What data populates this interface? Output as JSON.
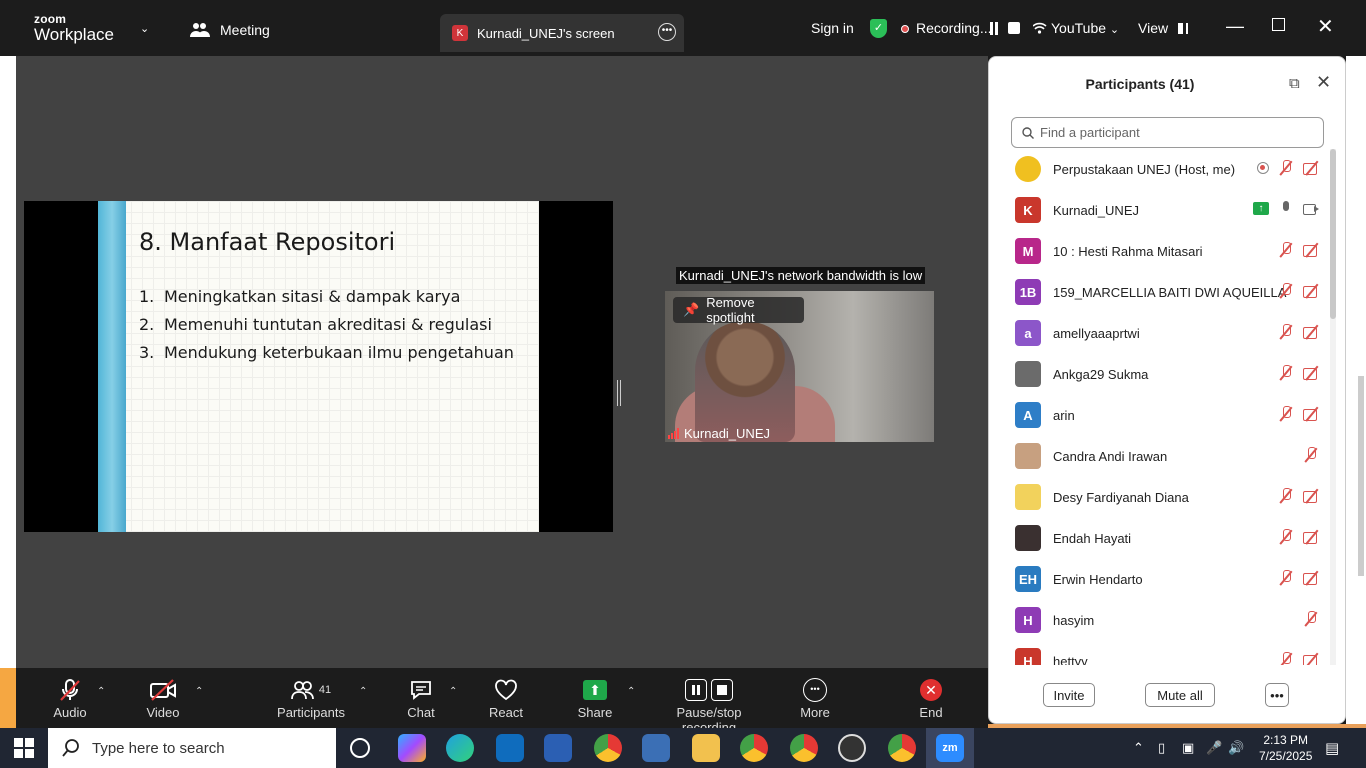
{
  "titlebar": {
    "logo_top": "zoom",
    "logo_bottom": "Workplace",
    "meeting_label": "Meeting",
    "tab_badge": "K",
    "tab_label": "Kurnadi_UNEJ's screen",
    "sign_in": "Sign in",
    "recording_label": "Recording...",
    "youtube_label": "YouTube",
    "view_label": "View"
  },
  "slide": {
    "title": "8. Manfaat Repositori",
    "items": [
      {
        "num": "1.",
        "text": "Meningkatkan sitasi & dampak karya"
      },
      {
        "num": "2.",
        "text": "Memenuhi tuntutan akreditasi & regulasi"
      },
      {
        "num": "3.",
        "text": "Mendukung keterbukaan ilmu pengetahuan"
      }
    ]
  },
  "video": {
    "warning": "Kurnadi_UNEJ's network bandwidth is low",
    "remove_spotlight": "Remove spotlight",
    "name": "Kurnadi_UNEJ"
  },
  "participants": {
    "title": "Participants (41)",
    "search_placeholder": "Find a participant",
    "list": [
      {
        "initials": "",
        "color": "#f0c020",
        "name": "Perpustakaan UNEJ (Host, me)",
        "icons": [
          "rec",
          "mic-off",
          "cam-off"
        ]
      },
      {
        "initials": "K",
        "color": "#c9372c",
        "name": "Kurnadi_UNEJ",
        "icons": [
          "share",
          "mic-on",
          "cam-on"
        ]
      },
      {
        "initials": "M",
        "color": "#b8278a",
        "name": "10 : Hesti Rahma Mitasari",
        "icons": [
          "mic-off",
          "cam-off"
        ]
      },
      {
        "initials": "1B",
        "color": "#8e3bb5",
        "name": "159_MARCELLIA BAITI DWI AQUEILLA",
        "icons": [
          "mic-off",
          "cam-off"
        ]
      },
      {
        "initials": "a",
        "color": "#8c56c9",
        "name": "amellyaaaprtwi",
        "icons": [
          "mic-off",
          "cam-off"
        ]
      },
      {
        "initials": "",
        "color": "#6b6b6b",
        "name": "Ankga29 Sukma",
        "icons": [
          "mic-off",
          "cam-off"
        ]
      },
      {
        "initials": "A",
        "color": "#2e7ec7",
        "name": "arin",
        "icons": [
          "mic-off",
          "cam-off"
        ]
      },
      {
        "initials": "",
        "color": "#c7a080",
        "name": "Candra Andi Irawan",
        "icons": [
          "mic-off"
        ]
      },
      {
        "initials": "",
        "color": "#f2d25c",
        "name": "Desy Fardiyanah Diana",
        "icons": [
          "mic-off",
          "cam-off"
        ]
      },
      {
        "initials": "",
        "color": "#3a3030",
        "name": "Endah Hayati",
        "icons": [
          "mic-off",
          "cam-off"
        ]
      },
      {
        "initials": "EH",
        "color": "#2a7bc0",
        "name": "Erwin Hendarto",
        "icons": [
          "mic-off",
          "cam-off"
        ]
      },
      {
        "initials": "H",
        "color": "#8e3bb5",
        "name": "hasyim",
        "icons": [
          "mic-off"
        ]
      },
      {
        "initials": "H",
        "color": "#c9372c",
        "name": "hettyy",
        "icons": [
          "mic-off",
          "cam-off"
        ]
      }
    ],
    "invite": "Invite",
    "mute_all": "Mute all"
  },
  "toolbar": {
    "audio": "Audio",
    "video": "Video",
    "participants": "Participants",
    "participants_count": "41",
    "chat": "Chat",
    "react": "React",
    "share": "Share",
    "pause_stop": "Pause/stop recording",
    "more": "More",
    "end": "End"
  },
  "taskbar": {
    "search_placeholder": "Type here to search",
    "time": "2:13 PM",
    "date": "7/25/2025"
  },
  "colors": {
    "share_green": "#1fa84a",
    "mute_red": "#d9534f",
    "end_red": "#e02f2f"
  }
}
